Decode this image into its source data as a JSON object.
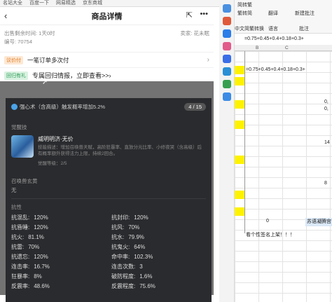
{
  "browser": {
    "bookmarks": [
      "名站大全",
      "百度一下",
      "网易精选",
      "京东商城"
    ]
  },
  "phone": {
    "title": "商品详情",
    "meta_left": "出售剩余时间: 1天0时",
    "meta_right": "卖家: 花未眠",
    "code": "编号: 70754",
    "row1_tag": "议价付",
    "row1_text": "一笔订单多次付",
    "row2_tag": "回归有礼",
    "row2_text": "专属回归情报，立即查看>>"
  },
  "card": {
    "skill_line": "强心术（含高级）触发概率增加5.2%",
    "page": "4 / 15",
    "section_skill": "觉醒技",
    "skill_name": "威明明济·无价",
    "skill_desc": "技能描述：增加召唤兽天赋，高阶狂暴率、直放分元比率、小修夜哭（含高级）后有概率额外获得法力上限，持续2回合。",
    "skill_level": "觉醒等级：2/5",
    "section_summon": "召唤兽玄黄",
    "summon_none": "无",
    "section_resist": "抗性",
    "stats": [
      {
        "k": "抗混乱:",
        "v": "120%"
      },
      {
        "k": "抗封印:",
        "v": "120%"
      },
      {
        "k": "抗昏睡:",
        "v": "120%"
      },
      {
        "k": "抗风:",
        "v": "70%"
      },
      {
        "k": "抗火:",
        "v": "81.1%"
      },
      {
        "k": "抗水:",
        "v": "79.9%"
      },
      {
        "k": "抗雷:",
        "v": "70%"
      },
      {
        "k": "抗鬼火:",
        "v": "64%"
      },
      {
        "k": "抗遗忘:",
        "v": "120%"
      },
      {
        "k": "命中率:",
        "v": "102.3%"
      },
      {
        "k": "连击率:",
        "v": "16.7%"
      },
      {
        "k": "连击次数:",
        "v": "3"
      },
      {
        "k": "狂暴率:",
        "v": "8%"
      },
      {
        "k": "破防程度:",
        "v": "1.6%"
      },
      {
        "k": "反震率:",
        "v": "48.6%"
      },
      {
        "k": "反震程度:",
        "v": "75.6%"
      }
    ]
  },
  "excel": {
    "ribbon_items": [
      "简转繁",
      "繁转简",
      "中文简繁转换",
      "翻译",
      "语言",
      "批注",
      "新建批注"
    ],
    "formula": "=0.75+0.45+0.4+0.18+0.3+",
    "cols": [
      "B",
      "C"
    ],
    "cell_formula": "=0.75+0.45+0.4+0.18+0.3+",
    "cell_right_1": "0,",
    "cell_right_2": "0,",
    "cell_right_3": "14",
    "cell_right_4": "8",
    "cell_zero": "0",
    "cell_blue": "苏语凝腾宫",
    "cell_footer": "看个性签名上架！！！"
  }
}
